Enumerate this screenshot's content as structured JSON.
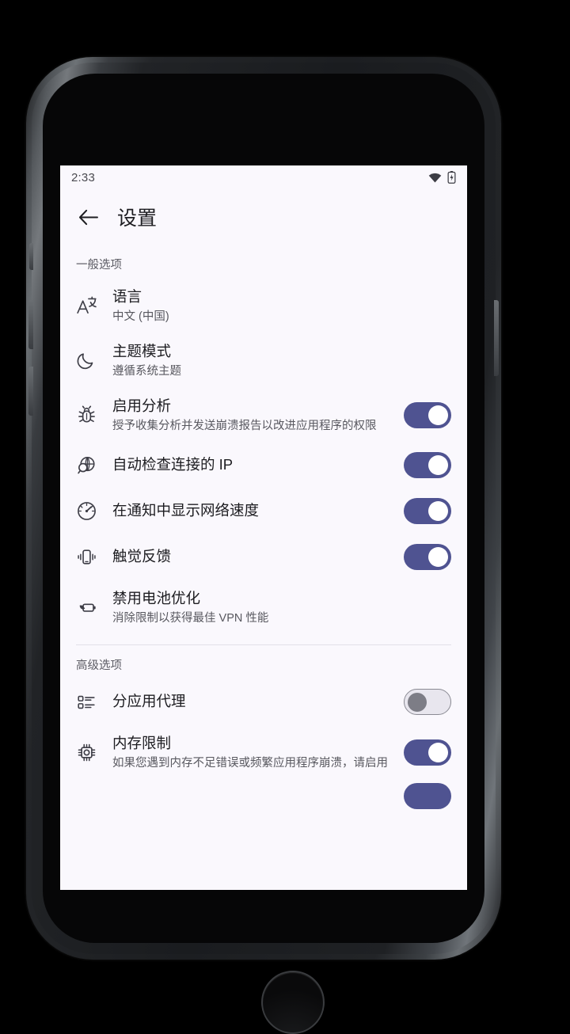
{
  "status_bar": {
    "time": "2:33",
    "wifi_icon": "wifi-icon",
    "battery_icon": "battery-charging-icon"
  },
  "app_bar": {
    "back_icon": "back-arrow-icon",
    "title": "设置"
  },
  "colors": {
    "toggle_on": "#4f5391",
    "toggle_off_track": "#e8e6ee",
    "toggle_off_thumb": "#7d7d86",
    "screen_bg": "#faf8fd",
    "title_text": "#1d1d21",
    "subtitle_text": "#58585f",
    "divider": "#e2e0e9"
  },
  "sections": [
    {
      "header": "一般选项",
      "rows": [
        {
          "icon": "translate-icon",
          "title": "语言",
          "subtitle": "中文 (中国)",
          "control": "none"
        },
        {
          "icon": "moon-icon",
          "title": "主题模式",
          "subtitle": "遵循系统主题",
          "control": "none"
        },
        {
          "icon": "bug-icon",
          "title": "启用分析",
          "subtitle": "授予收集分析并发送崩溃报告以改进应用程序的权限",
          "control": "toggle",
          "toggle_state": "on"
        },
        {
          "icon": "globe-search-icon",
          "title": "自动检查连接的 IP",
          "subtitle": "",
          "control": "toggle",
          "toggle_state": "on"
        },
        {
          "icon": "speedometer-icon",
          "title": "在通知中显示网络速度",
          "subtitle": "",
          "control": "toggle",
          "toggle_state": "on"
        },
        {
          "icon": "vibration-icon",
          "title": "触觉反馈",
          "subtitle": "",
          "control": "toggle",
          "toggle_state": "on"
        },
        {
          "icon": "battery-leaf-icon",
          "title": "禁用电池优化",
          "subtitle": "消除限制以获得最佳 VPN 性能",
          "control": "none"
        }
      ]
    },
    {
      "header": "高级选项",
      "rows": [
        {
          "icon": "app-list-icon",
          "title": "分应用代理",
          "subtitle": "",
          "control": "toggle",
          "toggle_state": "off"
        },
        {
          "icon": "memory-chip-icon",
          "title": "内存限制",
          "subtitle": "如果您遇到内存不足错误或频繁应用程序崩溃，请启用",
          "control": "toggle",
          "toggle_state": "on"
        }
      ]
    }
  ],
  "partial_row": {
    "toggle_state": "on"
  }
}
